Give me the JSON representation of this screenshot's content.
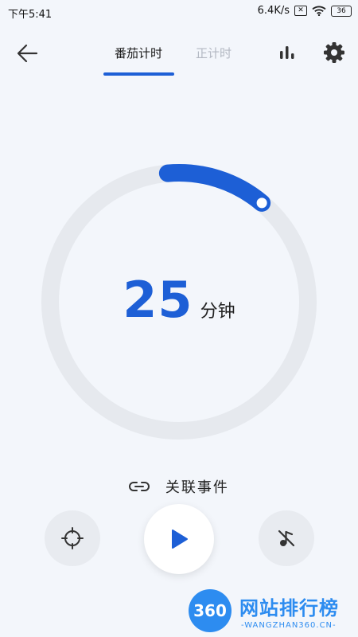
{
  "status": {
    "time": "下午5:41",
    "net_speed": "6.4K/s",
    "sim": "✕",
    "battery": "36"
  },
  "tabs": [
    {
      "label": "番茄计时",
      "active": true
    },
    {
      "label": "正计时",
      "active": false
    }
  ],
  "timer": {
    "value": "25",
    "unit": "分钟",
    "progress_fraction": 0.125
  },
  "link_event": {
    "label": "关联事件"
  },
  "watermark": {
    "badge": "360",
    "title": "网站排行榜",
    "subtitle": "-WANGZHAN360.CN-"
  },
  "colors": {
    "accent": "#1d5fd6",
    "track": "#e6e9ee",
    "background": "#f3f6fb",
    "inactive_tab": "#b3b8c2"
  },
  "icons": [
    "back-arrow-icon",
    "bar-chart-icon",
    "gear-icon",
    "link-icon",
    "crosshair-icon",
    "play-icon",
    "music-off-icon"
  ]
}
